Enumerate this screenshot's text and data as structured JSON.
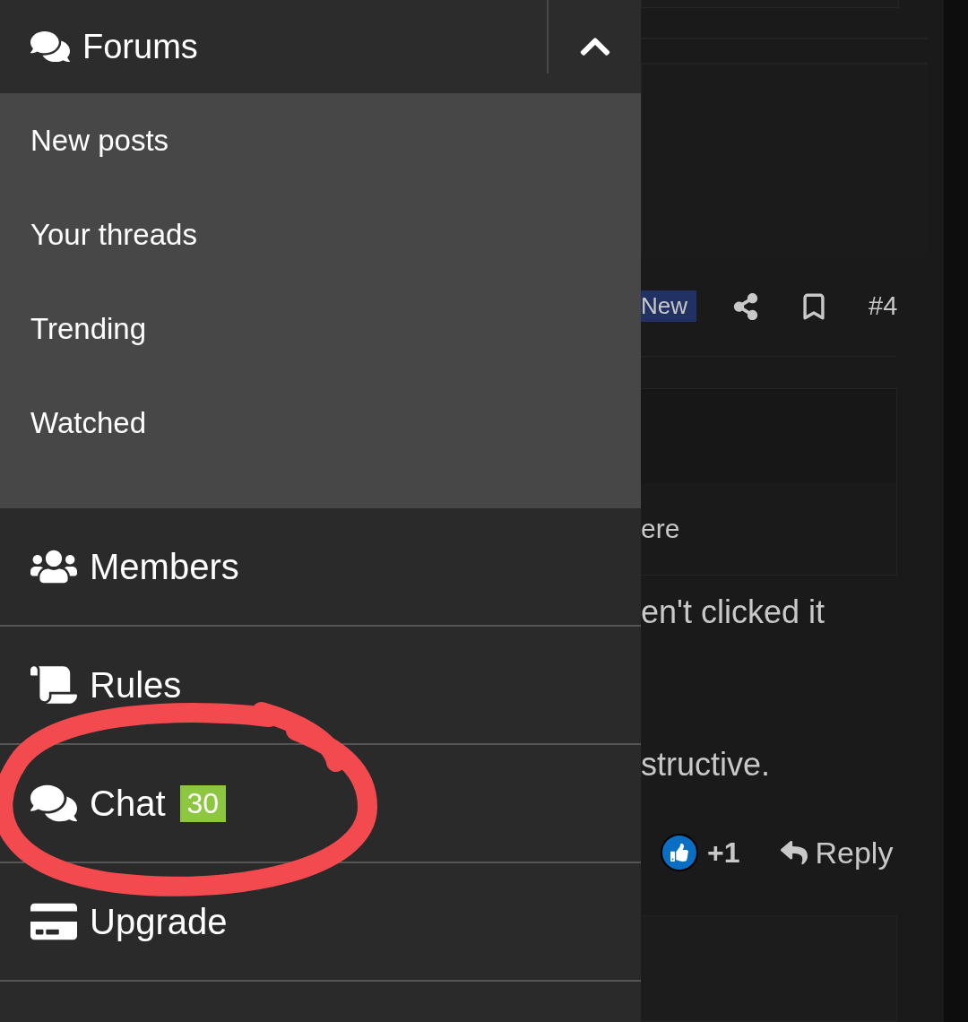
{
  "drawer": {
    "header": {
      "label": "Forums",
      "expanded": true
    },
    "subitems": [
      {
        "label": "New posts"
      },
      {
        "label": "Your threads"
      },
      {
        "label": "Trending"
      },
      {
        "label": "Watched"
      }
    ],
    "items": [
      {
        "label": "Members"
      },
      {
        "label": "Rules"
      },
      {
        "label": "Chat",
        "badge": "30"
      },
      {
        "label": "Upgrade"
      }
    ]
  },
  "post": {
    "badge": "New",
    "number": "#4",
    "quote_text": "ere",
    "lines": [
      "en't clicked it",
      "structive."
    ],
    "reaction_count": "+1",
    "reply_label": "Reply"
  }
}
